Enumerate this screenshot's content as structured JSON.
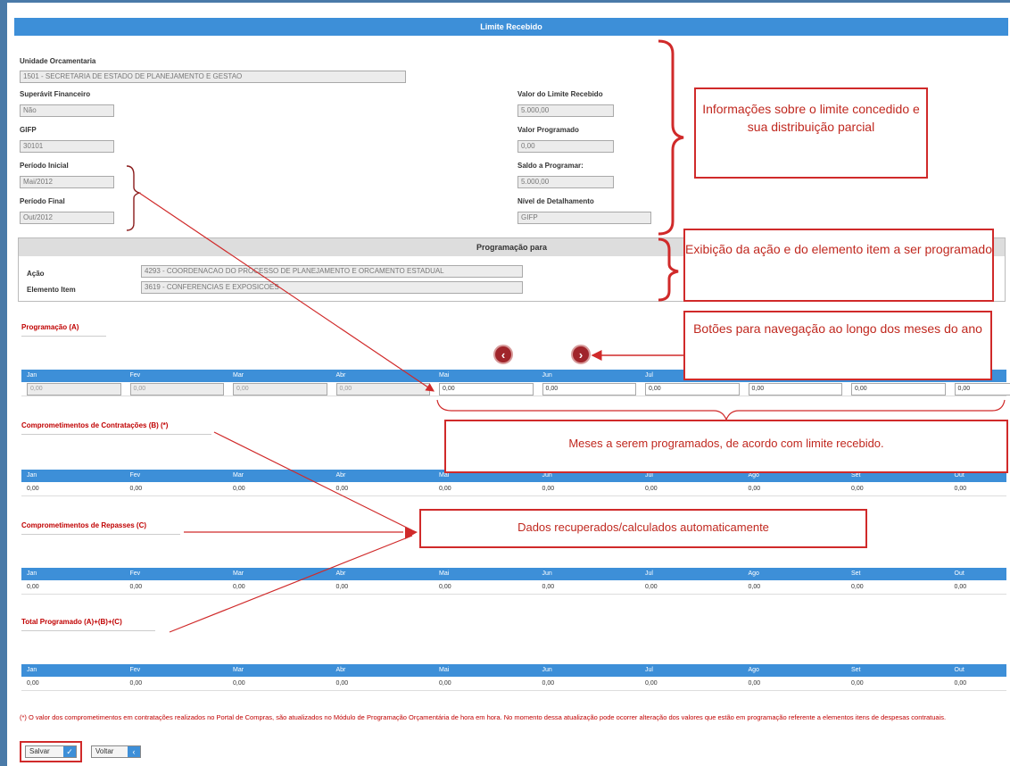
{
  "window": {
    "title": "Limite Recebido"
  },
  "info": {
    "unidade": {
      "label": "Unidade Orcamentaria",
      "value": "1501 - SECRETARIA DE ESTADO DE PLANEJAMENTO E GESTAO"
    },
    "superavit": {
      "label": "Superávit Financeiro",
      "value": "Não"
    },
    "gifp": {
      "label": "GIFP",
      "value": "30101"
    },
    "periodo_inicial": {
      "label": "Período Inicial",
      "value": "Mai/2012"
    },
    "periodo_final": {
      "label": "Período Final",
      "value": "Out/2012"
    },
    "valor_limite": {
      "label": "Valor do Limite Recebido",
      "value": "5.000,00"
    },
    "valor_programado": {
      "label": "Valor Programado",
      "value": "0,00"
    },
    "saldo": {
      "label": "Saldo a Programar:",
      "value": "5.000,00"
    },
    "nivel": {
      "label": "Nível de Detalhamento",
      "value": "GIFP"
    }
  },
  "programacao_para": {
    "title": "Programação para",
    "acao": {
      "label": "Ação",
      "value": "4293 - COORDENACAO DO PROCESSO DE PLANEJAMENTO E ORCAMENTO ESTADUAL"
    },
    "elemento": {
      "label": "Elemento Item",
      "value": "3619 - CONFERENCIAS E EXPOSICOES"
    }
  },
  "months": [
    "Jan",
    "Fev",
    "Mar",
    "Abr",
    "Mai",
    "Jun",
    "Jul",
    "Ago",
    "Set",
    "Out"
  ],
  "sections": {
    "programacao": {
      "title": "Programação (A)",
      "values": [
        "0,00",
        "0,00",
        "0,00",
        "0,00",
        "0,00",
        "0,00",
        "0,00",
        "0,00",
        "0,00",
        "0,00"
      ]
    },
    "contratacoes": {
      "title": "Comprometimentos de Contratações (B) (*)",
      "values": [
        "0,00",
        "0,00",
        "0,00",
        "0,00",
        "0,00",
        "0,00",
        "0,00",
        "0,00",
        "0,00",
        "0,00"
      ]
    },
    "repasses": {
      "title": "Comprometimentos de Repasses (C)",
      "values": [
        "0,00",
        "0,00",
        "0,00",
        "0,00",
        "0,00",
        "0,00",
        "0,00",
        "0,00",
        "0,00",
        "0,00"
      ]
    },
    "total": {
      "title": "Total Programado (A)+(B)+(C)",
      "values": [
        "0,00",
        "0,00",
        "0,00",
        "0,00",
        "0,00",
        "0,00",
        "0,00",
        "0,00",
        "0,00",
        "0,00"
      ]
    }
  },
  "nav": {
    "prev_icon": "chevron-left-icon",
    "next_icon": "chevron-right-icon"
  },
  "callouts": {
    "info": "Informações sobre o limite concedido e sua distribuição parcial",
    "acao": "Exibição da ação e do elemento item a ser programado",
    "nav": "Botões para navegação ao longo dos meses do ano",
    "meses": "Meses a serem programados, de acordo com limite recebido.",
    "dados": "Dados recuperados/calculados  automaticamente"
  },
  "footnote": "(*) O valor dos comprometimentos em contratações realizados no Portal de Compras, são atualizados no Módulo de Programação Orçamentária de hora em hora. No momento dessa atualização pode ocorrer alteração dos valores que estão em programação referente a elementos itens de despesas contratuais.",
  "buttons": {
    "salvar": "Salvar",
    "voltar": "Voltar"
  },
  "colors": {
    "header_blue": "#3d8fd8",
    "annotation_red": "#d02a2a",
    "nav_button": "#a0252b"
  }
}
